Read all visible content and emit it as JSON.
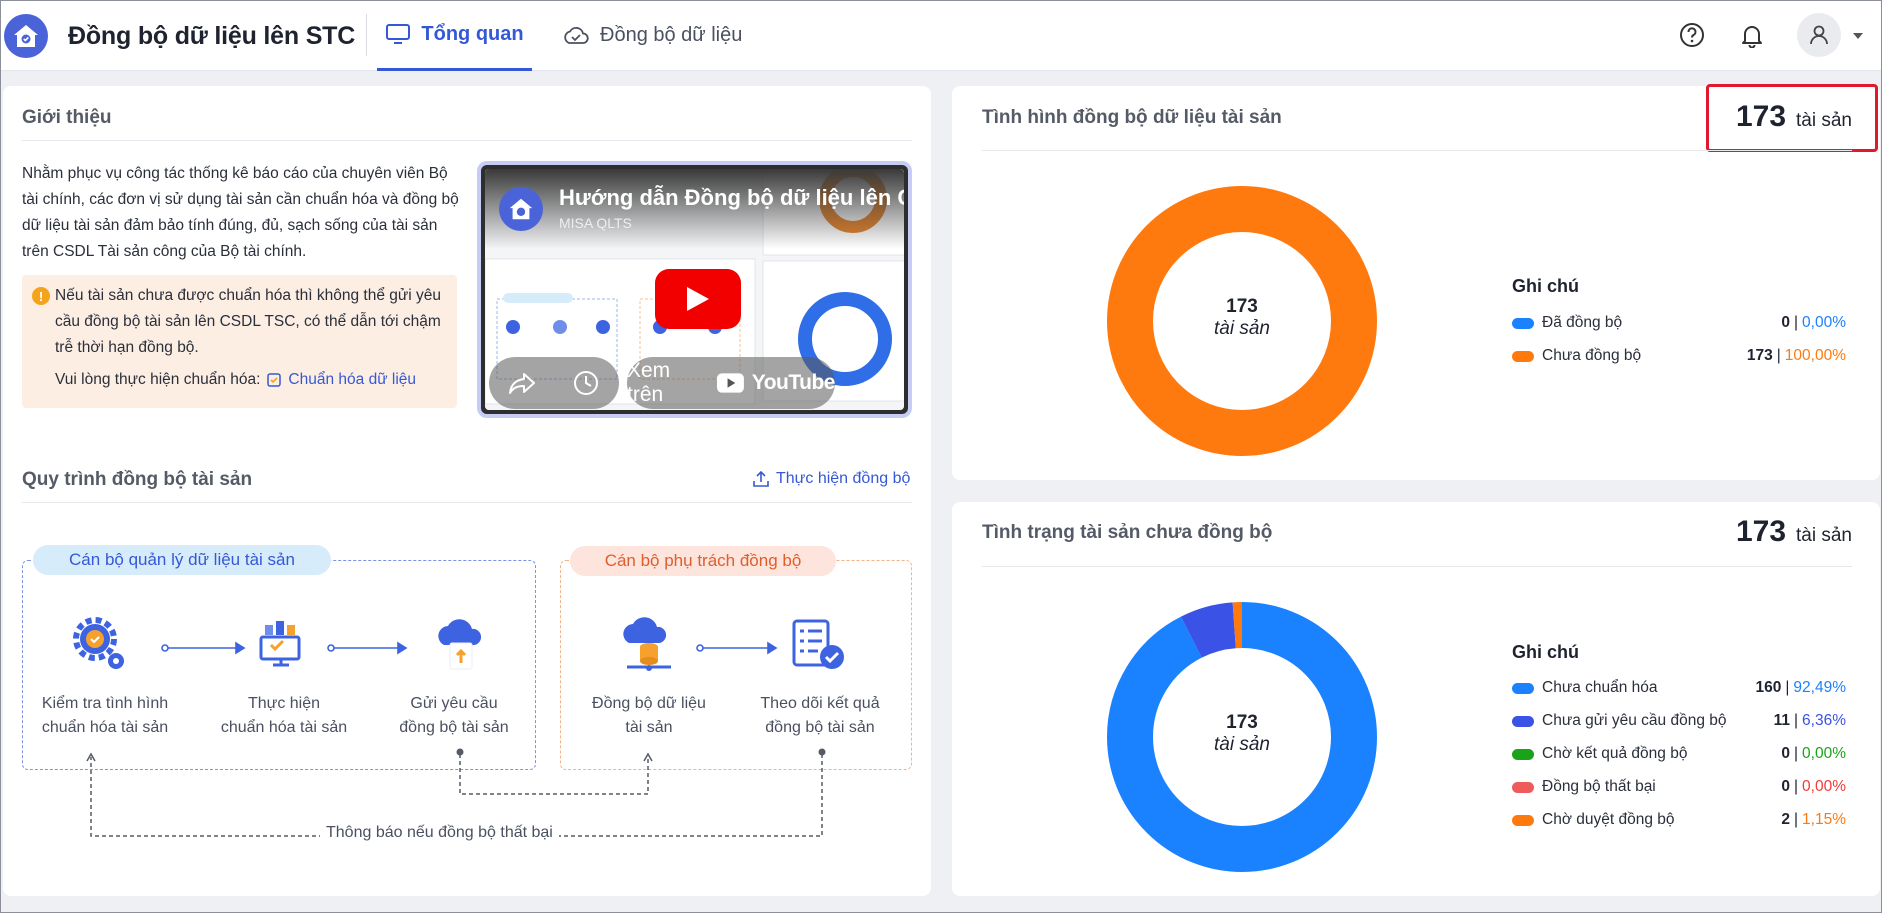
{
  "header": {
    "app_title": "Đồng bộ dữ liệu lên STC",
    "tabs": [
      {
        "label": "Tổng quan",
        "active": true
      },
      {
        "label": "Đồng bộ dữ liệu",
        "active": false
      }
    ]
  },
  "intro": {
    "title": "Giới thiệu",
    "body": "Nhằm phục vụ công tác thống kê báo cáo của chuyên viên Bộ tài chính, các đơn vị sử dụng tài sản cần chuẩn hóa và đồng bộ dữ liệu tài sản đảm bảo tính đúng, đủ, sạch sống của tài sản trên CSDL Tài sản công của Bộ tài chính.",
    "warning": "Nếu tài sản chưa được chuẩn hóa thì không thể gửi yêu cầu đồng bộ tài sản lên CSDL TSC, có thể dẫn tới chậm trễ thời hạn đồng bộ.",
    "cta_prefix": "Vui lòng thực hiện chuẩn hóa:",
    "cta_link": "Chuẩn hóa dữ liệu",
    "video": {
      "title": "Hướng dẫn Đồng bộ dữ liệu lên C",
      "channel": "MISA QLTS",
      "watch_on": "Xem trên",
      "youtube": "YouTube"
    }
  },
  "process": {
    "title": "Quy trình đồng bộ tài sản",
    "action": "Thực hiện đồng bộ",
    "group_left": "Cán bộ quản lý dữ liệu tài sản",
    "group_right": "Cán bộ phụ trách đồng bộ",
    "steps": [
      {
        "line1": "Kiểm tra tình hình",
        "line2": "chuẩn hóa tài sản",
        "icon": "gear-check-icon"
      },
      {
        "line1": "Thực hiện",
        "line2": "chuẩn hóa tài sản",
        "icon": "standardize-icon"
      },
      {
        "line1": "Gửi yêu cầu",
        "line2": "đồng bộ tài sản",
        "icon": "cloud-upload-icon"
      },
      {
        "line1": "Đồng bộ dữ liệu",
        "line2": "tài sản",
        "icon": "cloud-database-icon"
      },
      {
        "line1": "Theo dõi kết quả",
        "line2": "đồng bộ tài sản",
        "icon": "checklist-icon"
      }
    ],
    "notify": "Thông báo nếu đồng bộ thất bại"
  },
  "sync_status": {
    "title": "Tình hình đồng bộ dữ liệu tài sản",
    "count": "173",
    "unit": "tài sản",
    "center_count": "173",
    "center_unit": "tài sản",
    "legend_title": "Ghi chú",
    "items": [
      {
        "label": "Đã đồng bộ",
        "value": "0",
        "pct": "0,00%",
        "color": "#1a82ff",
        "pct_color": "#1a82ff",
        "fraction": 0.0
      },
      {
        "label": "Chưa đồng bộ",
        "value": "173",
        "pct": "100,00%",
        "color": "#ff7a0e",
        "pct_color": "#ff7a0e",
        "fraction": 1.0
      }
    ]
  },
  "unsynced": {
    "title": "Tình trạng tài sản chưa đồng bộ",
    "count": "173",
    "unit": "tài sản",
    "center_count": "173",
    "center_unit": "tài sản",
    "legend_title": "Ghi chú",
    "items": [
      {
        "label": "Chưa chuẩn hóa",
        "value": "160",
        "pct": "92,49%",
        "color": "#1a82ff",
        "pct_color": "#1a82ff",
        "fraction": 0.9249
      },
      {
        "label": "Chưa gửi yêu cầu đồng bộ",
        "value": "11",
        "pct": "6,36%",
        "color": "#3a52e6",
        "pct_color": "#3a52e6",
        "fraction": 0.0636
      },
      {
        "label": "Chờ kết quả đồng bộ",
        "value": "0",
        "pct": "0,00%",
        "color": "#1aa319",
        "pct_color": "#1aa319",
        "fraction": 0.0
      },
      {
        "label": "Đồng bộ thất bại",
        "value": "0",
        "pct": "0,00%",
        "color": "#ef5b5b",
        "pct_color": "#ef3b3b",
        "fraction": 0.0
      },
      {
        "label": "Chờ duyệt đồng bộ",
        "value": "2",
        "pct": "1,15%",
        "color": "#ff7a0e",
        "pct_color": "#ff7a0e",
        "fraction": 0.0115
      }
    ]
  }
}
